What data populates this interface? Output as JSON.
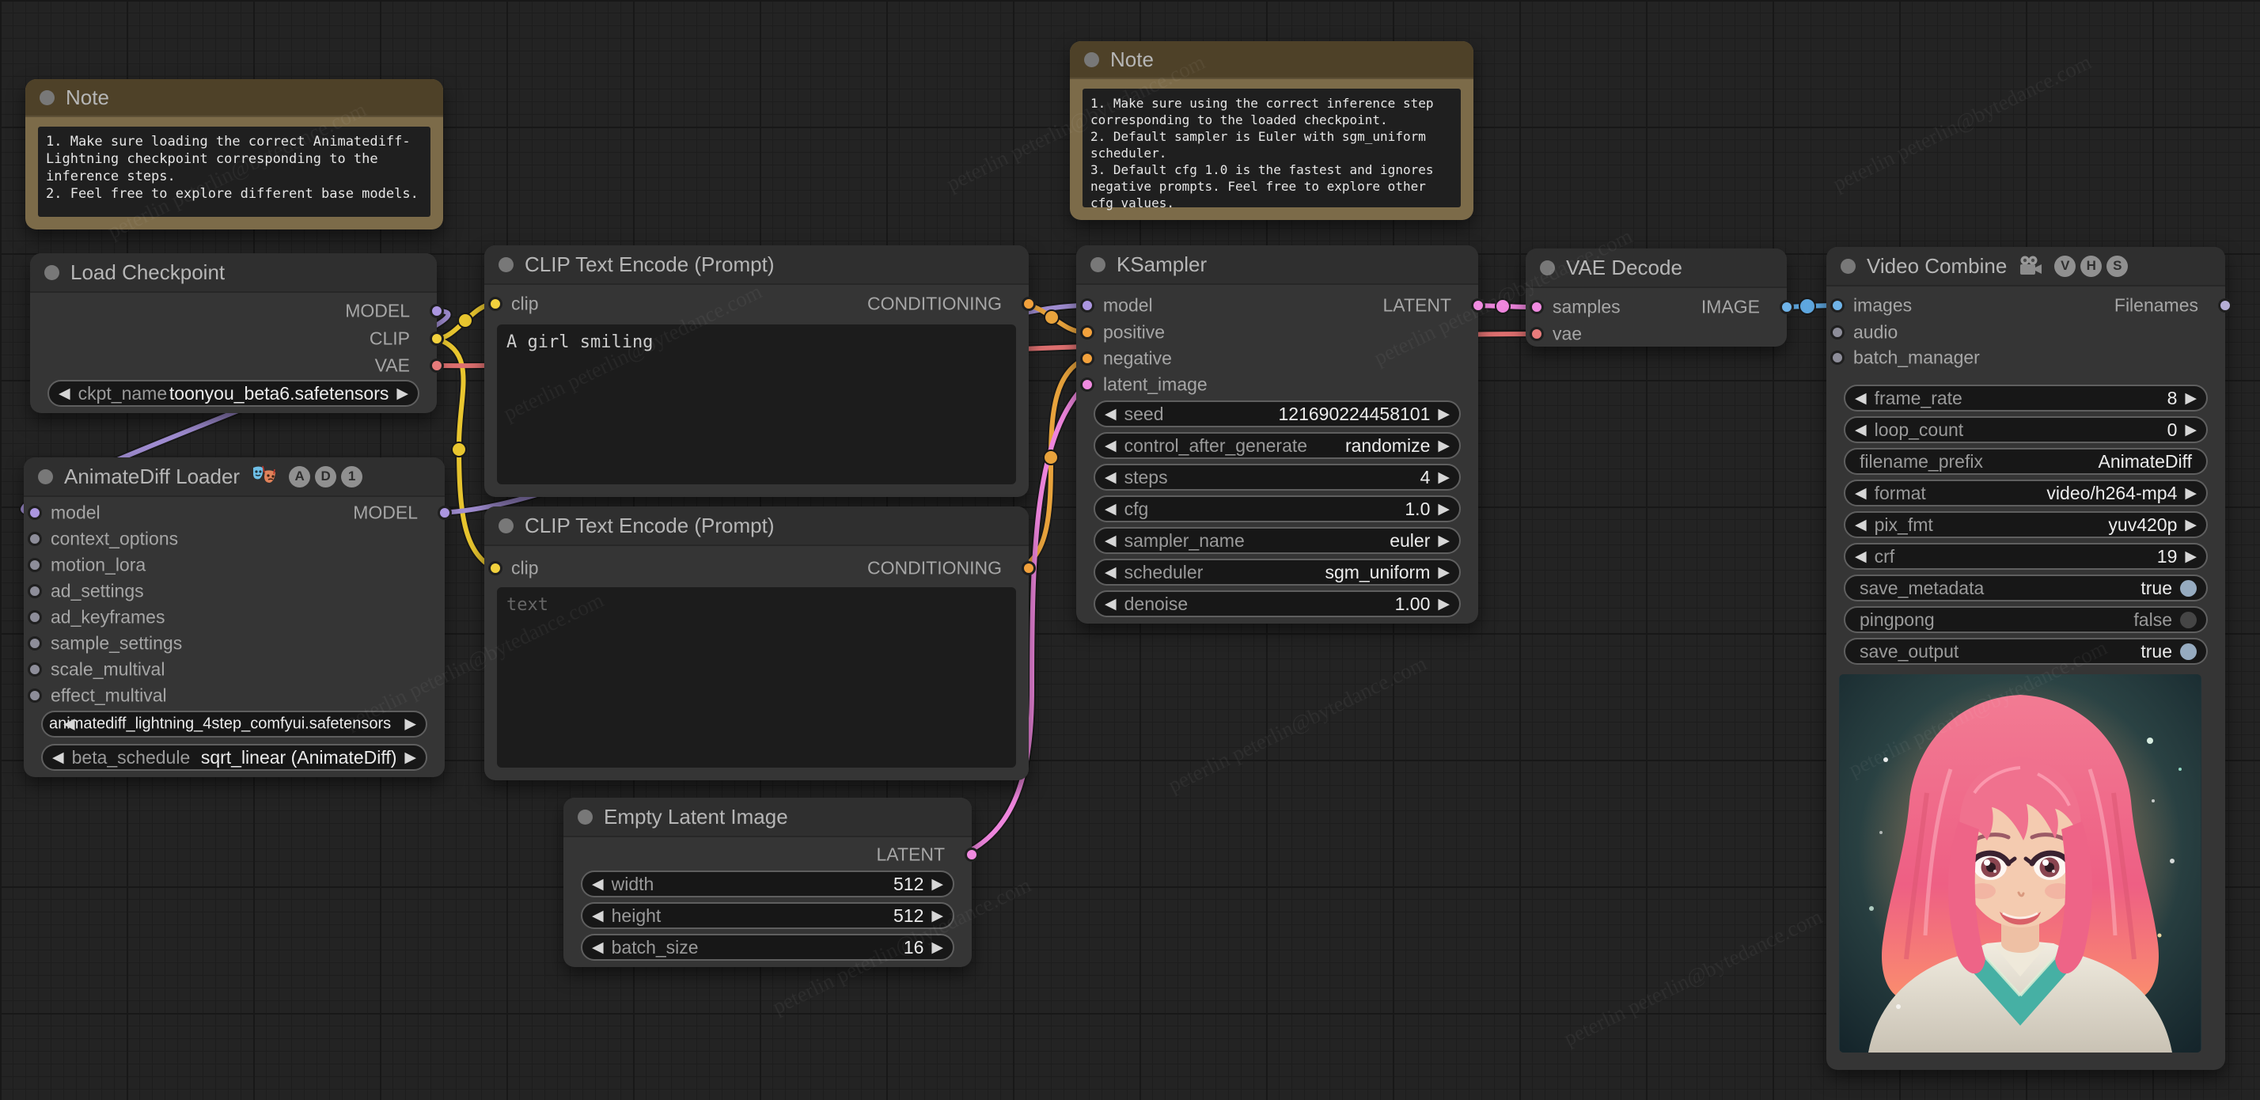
{
  "ui": {
    "arrow_left": "◀",
    "arrow_right": "▶"
  },
  "watermark": {
    "text": "peterlin peterlin@bytedance.com"
  },
  "colors": {
    "model": "#ab96e0",
    "clip": "#f2d13d",
    "vae": "#e77b7b",
    "conditioning": "#f2a13c",
    "latent": "#f08ae0",
    "image": "#6fb3e8",
    "filenames": "#b6aed6",
    "unconnected": "#8d8d99",
    "note_header": "#4e4128",
    "note_body": "#7c6b49",
    "node_body": "#353535",
    "node_header": "#2f2f2f",
    "toggle_on": "#96abc0",
    "toggle_off": "#454545"
  },
  "nodes": {
    "note1": {
      "title": "Note",
      "lines": [
        "1. Make sure loading the correct Animatediff-",
        "Lightning checkpoint corresponding to the",
        "inference steps.",
        "2. Feel free to explore different base models."
      ]
    },
    "note2": {
      "title": "Note",
      "lines": [
        "1. Make sure using the correct inference step",
        "corresponding to the loaded checkpoint.",
        "2. Default sampler is Euler with sgm_uniform",
        "scheduler.",
        "3. Default cfg 1.0 is the fastest and ignores",
        "negative prompts. Feel free to explore other",
        "cfg values."
      ]
    },
    "load_checkpoint": {
      "title": "Load Checkpoint",
      "outputs": [
        {
          "label": "MODEL"
        },
        {
          "label": "CLIP"
        },
        {
          "label": "VAE"
        }
      ],
      "widgets": [
        {
          "name": "ckpt_name",
          "value": "toonyou_beta6.safetensors"
        }
      ]
    },
    "animatediff": {
      "title": "AnimateDiff Loader",
      "badges": [
        "A",
        "D",
        "1"
      ],
      "inputs": [
        {
          "label": "model"
        },
        {
          "label": "context_options"
        },
        {
          "label": "motion_lora"
        },
        {
          "label": "ad_settings"
        },
        {
          "label": "ad_keyframes"
        },
        {
          "label": "sample_settings"
        },
        {
          "label": "scale_multival"
        },
        {
          "label": "effect_multival"
        }
      ],
      "outputs": [
        {
          "label": "MODEL"
        }
      ],
      "widgets": [
        {
          "value": "animatediff_lightning_4step_comfyui.safetensors"
        },
        {
          "name": "beta_schedule",
          "value": "sqrt_linear (AnimateDiff)"
        }
      ]
    },
    "clip_positive": {
      "title": "CLIP Text Encode (Prompt)",
      "inputs": [
        {
          "label": "clip"
        }
      ],
      "outputs": [
        {
          "label": "CONDITIONING"
        }
      ],
      "text": "A girl smiling"
    },
    "clip_negative": {
      "title": "CLIP Text Encode (Prompt)",
      "inputs": [
        {
          "label": "clip"
        }
      ],
      "outputs": [
        {
          "label": "CONDITIONING"
        }
      ],
      "placeholder": "text"
    },
    "empty_latent": {
      "title": "Empty Latent Image",
      "outputs": [
        {
          "label": "LATENT"
        }
      ],
      "widgets": [
        {
          "name": "width",
          "value": "512"
        },
        {
          "name": "height",
          "value": "512"
        },
        {
          "name": "batch_size",
          "value": "16"
        }
      ]
    },
    "ksampler": {
      "title": "KSampler",
      "inputs": [
        {
          "label": "model"
        },
        {
          "label": "positive"
        },
        {
          "label": "negative"
        },
        {
          "label": "latent_image"
        }
      ],
      "outputs": [
        {
          "label": "LATENT"
        }
      ],
      "widgets": [
        {
          "name": "seed",
          "value": "121690224458101"
        },
        {
          "name": "control_after_generate",
          "value": "randomize"
        },
        {
          "name": "steps",
          "value": "4"
        },
        {
          "name": "cfg",
          "value": "1.0"
        },
        {
          "name": "sampler_name",
          "value": "euler"
        },
        {
          "name": "scheduler",
          "value": "sgm_uniform"
        },
        {
          "name": "denoise",
          "value": "1.00"
        }
      ]
    },
    "vae_decode": {
      "title": "VAE Decode",
      "inputs": [
        {
          "label": "samples"
        },
        {
          "label": "vae"
        }
      ],
      "outputs": [
        {
          "label": "IMAGE"
        }
      ]
    },
    "video_combine": {
      "title": "Video Combine",
      "badges": [
        "V",
        "H",
        "S"
      ],
      "inputs": [
        {
          "label": "images"
        },
        {
          "label": "audio"
        },
        {
          "label": "batch_manager"
        }
      ],
      "outputs": [
        {
          "label": "Filenames"
        }
      ],
      "widgets": [
        {
          "name": "frame_rate",
          "value": "8"
        },
        {
          "name": "loop_count",
          "value": "0"
        },
        {
          "name": "filename_prefix",
          "value": "AnimateDiff"
        },
        {
          "name": "format",
          "value": "video/h264-mp4"
        },
        {
          "name": "pix_fmt",
          "value": "yuv420p"
        },
        {
          "name": "crf",
          "value": "19"
        },
        {
          "name": "save_metadata",
          "value": "true"
        },
        {
          "name": "pingpong",
          "value": "false"
        },
        {
          "name": "save_output",
          "value": "true"
        }
      ]
    }
  }
}
